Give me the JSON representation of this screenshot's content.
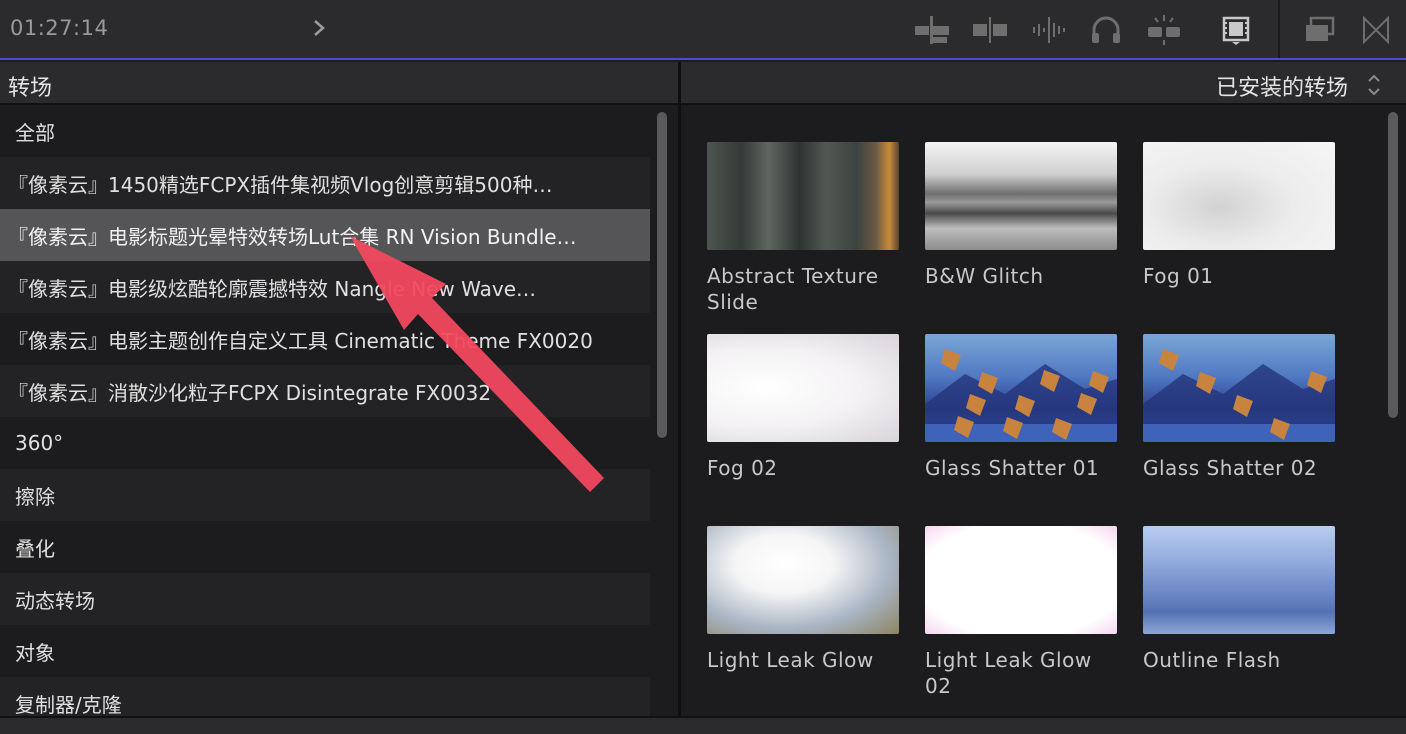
{
  "toolbar": {
    "timecode": "01:27:14",
    "icons": [
      "clip-connect-icon",
      "split-icon",
      "waveform-icon",
      "headphones-icon",
      "solo-icon",
      "filmstrip-icon",
      "window-icon",
      "close-panel-icon"
    ]
  },
  "left_panel": {
    "title": "转场",
    "items": [
      {
        "label": "全部"
      },
      {
        "label": "『像素云』1450精选FCPX插件集视频Vlog创意剪辑500种…"
      },
      {
        "label": "『像素云』电影标题光晕特效转场Lut合集 RN Vision Bundle…"
      },
      {
        "label": "『像素云』电影级炫酷轮廓震撼特效 Nangle New Wave…"
      },
      {
        "label": "『像素云』电影主题创作自定义工具 Cinematic Theme FX0020"
      },
      {
        "label": "『像素云』消散沙化粒子FCPX Disintegrate FX0032"
      },
      {
        "label": "360°"
      },
      {
        "label": "擦除"
      },
      {
        "label": "叠化"
      },
      {
        "label": "动态转场"
      },
      {
        "label": "对象"
      },
      {
        "label": "复制器/克隆"
      }
    ],
    "selected_index": 2
  },
  "right_panel": {
    "selector_label": "已安装的转场",
    "transitions": [
      {
        "label": "Abstract Texture Slide",
        "style": "abstract"
      },
      {
        "label": "B&W Glitch",
        "style": "glitch"
      },
      {
        "label": "Fog 01",
        "style": "fog"
      },
      {
        "label": "Fog 02",
        "style": "fog2"
      },
      {
        "label": "Glass Shatter 01",
        "style": "shatter"
      },
      {
        "label": "Glass Shatter 02",
        "style": "shatter2"
      },
      {
        "label": "Light Leak Glow",
        "style": "leak"
      },
      {
        "label": "Light Leak Glow 02",
        "style": "leak2"
      },
      {
        "label": "Outline Flash",
        "style": "outline"
      }
    ]
  },
  "colors": {
    "accent_line": "#4a4ad0",
    "selection": "#555557",
    "annotation_arrow": "#f2485e"
  }
}
